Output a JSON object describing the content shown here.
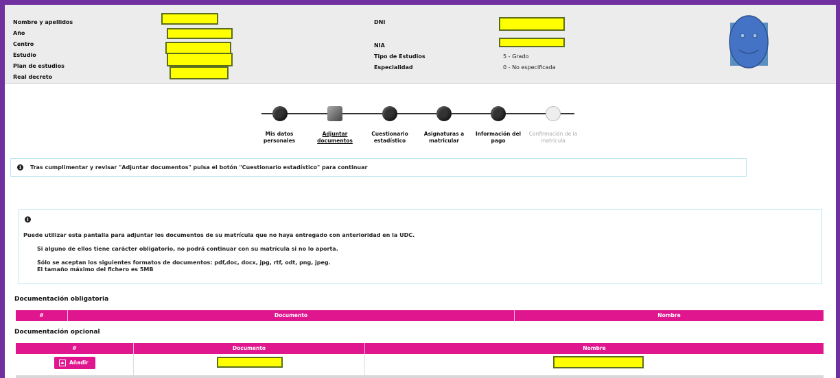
{
  "student": {
    "labels": {
      "name": "Nombre y apellidos",
      "year": "Año",
      "center": "Centro",
      "study": "Estudio",
      "plan": "Plan de estudios",
      "decree": "Real decreto",
      "dni": "DNI",
      "nia": "NIA",
      "study_type": "Tipo de Estudios",
      "specialty": "Especialidad"
    },
    "values": {
      "study_type": "5 - Grado",
      "specialty": "0 - No especificada"
    }
  },
  "steps": [
    {
      "label": "Mis datos personales",
      "state": "done"
    },
    {
      "label": "Adjuntar documentos",
      "state": "current"
    },
    {
      "label": "Cuestionario estadístico",
      "state": "done"
    },
    {
      "label": "Asignaturas a matricular",
      "state": "done"
    },
    {
      "label": "Información del pago",
      "state": "done"
    },
    {
      "label": "Confirmación de la matrícula",
      "state": "pending"
    }
  ],
  "notice": "Tras cumplimentar y revisar \"Adjuntar documentos\" pulsa el botón \"Cuestionario estadístico\" para continuar",
  "info_box": {
    "line1": "Puede utilizar esta pantalla para adjuntar los documentos de su matrícula que no haya entregado con anterioridad en la UDC.",
    "line2": "Si alguno de ellos tiene carácter obligatorio, no podrá continuar con su matrícula si no lo aporta.",
    "line3": "Sólo se aceptan los siguientes formatos de documentos: pdf,doc, docx, jpg, rtf, odt, png, jpeg.",
    "line4": "El tamaño máximo del fichero es 5MB"
  },
  "mandatory": {
    "title": "Documentación obligatoria",
    "columns": [
      "#",
      "Documento",
      "Nombre"
    ]
  },
  "optional": {
    "title": "Documentación opcional",
    "columns": [
      "#",
      "Documento",
      "Nombre"
    ],
    "add_label": "Añadir"
  },
  "colors": {
    "accent": "#e0168f",
    "frame": "#7030a0",
    "redaction": "#ffff00"
  },
  "icons": [
    "info-icon",
    "upload-icon",
    "avatar-face"
  ]
}
